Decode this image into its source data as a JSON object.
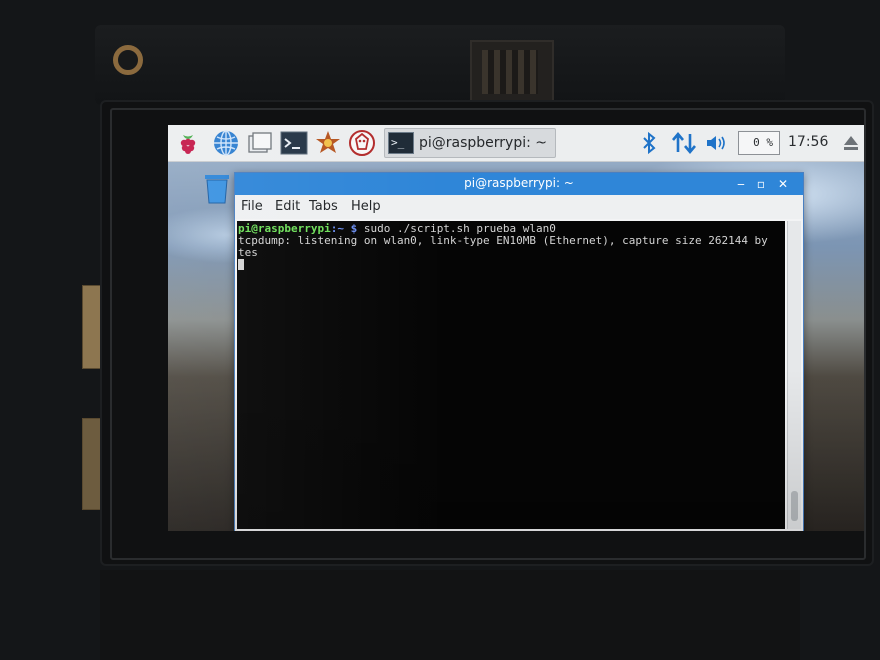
{
  "taskbar": {
    "launchers": [
      {
        "name": "raspberry-menu-icon"
      },
      {
        "name": "web-browser-icon"
      },
      {
        "name": "file-manager-icon"
      },
      {
        "name": "terminal-icon"
      },
      {
        "name": "math-kernel-icon"
      },
      {
        "name": "wolfram-icon"
      }
    ],
    "task_button_label": "pi@raspberrypi: ~",
    "task_button_glyph": ">_",
    "cpu_usage": "0 %",
    "clock": "17:56"
  },
  "desktop": {
    "icons": [
      {
        "name": "trash-icon"
      }
    ]
  },
  "terminal_window": {
    "title": "pi@raspberrypi: ~",
    "menu": [
      "File",
      "Edit",
      "Tabs",
      "Help"
    ],
    "lines": {
      "prompt_user": "pi@raspberrypi",
      "prompt_path": ":~ $",
      "command": " sudo ./script.sh prueba wlan0",
      "output_1": "tcpdump: listening on wlan0, link-type EN10MB (Ethernet), capture size 262144 by",
      "output_2": "tes"
    }
  },
  "colors": {
    "taskbar_bg": "#eceeef",
    "titlebar_bg": "#2f86d8",
    "terminal_bg": "#050505",
    "prompt_green": "#6ee05a",
    "prompt_blue": "#6a8df0"
  }
}
